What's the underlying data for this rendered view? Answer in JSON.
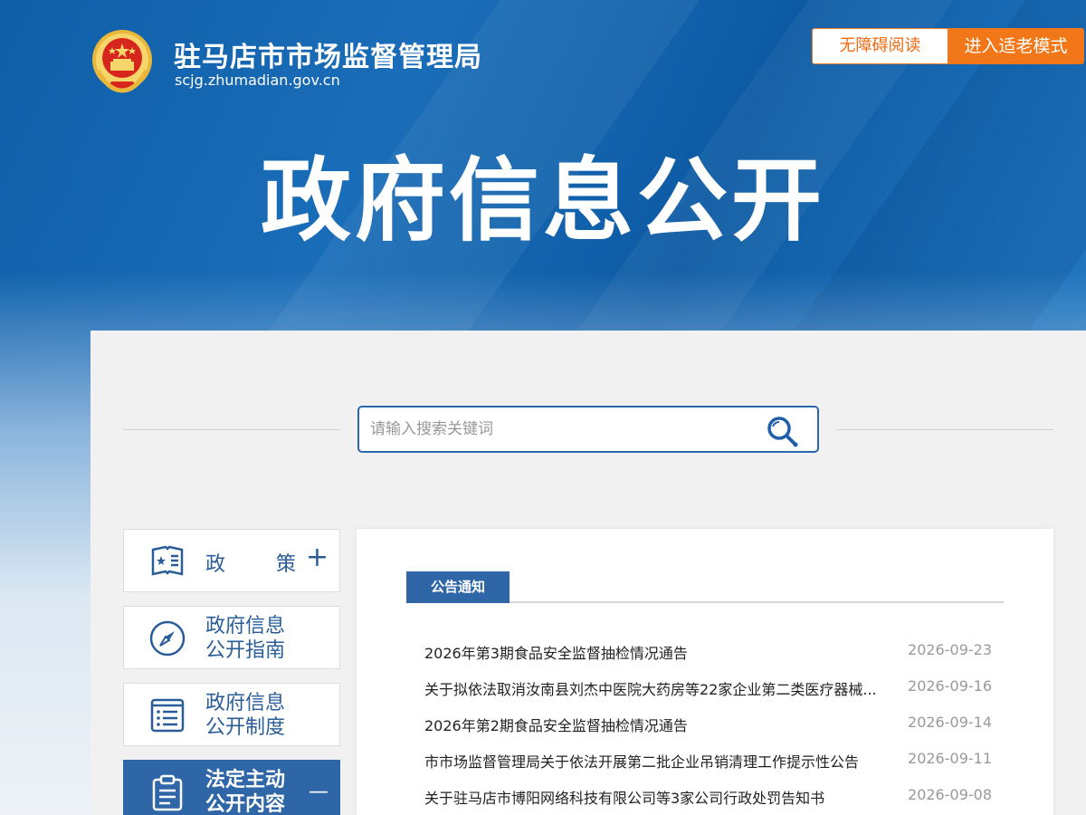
{
  "header": {
    "site_title": "驻马店市市场监督管理局",
    "site_url": "scjg.zhumadian.gov.cn",
    "accessibility_label": "无障碍阅读",
    "elder_mode_label": "进入适老模式"
  },
  "hero": {
    "title": "政府信息公开"
  },
  "search": {
    "placeholder": "请输入搜索关键词"
  },
  "sidebar": {
    "items": [
      {
        "label": "政策",
        "label_chars": [
          "政",
          "策"
        ],
        "toggle": "+",
        "icon": "policy-book-icon"
      },
      {
        "label_line1": "政府信息",
        "label_line2": "公开指南",
        "icon": "compass-icon"
      },
      {
        "label_line1": "政府信息",
        "label_line2": "公开制度",
        "icon": "list-document-icon"
      },
      {
        "label_line1": "法定主动",
        "label_line2": "公开内容",
        "toggle": "—",
        "icon": "clipboard-icon",
        "active": true
      }
    ]
  },
  "content": {
    "tab_label": "公告通知",
    "news": [
      {
        "title": "2026年第3期食品安全监督抽检情况通告",
        "date": "2026-09-23"
      },
      {
        "title": "关于拟依法取消汝南县刘杰中医院大药房等22家企业第二类医疗器械...",
        "date": "2026-09-16"
      },
      {
        "title": "2026年第2期食品安全监督抽检情况通告",
        "date": "2026-09-14"
      },
      {
        "title": "市市场监督管理局关于依法开展第二批企业吊销清理工作提示性公告",
        "date": "2026-09-11"
      },
      {
        "title": "关于驻马店市博阳网络科技有限公司等3家公司行政处罚告知书",
        "date": "2026-09-08"
      }
    ]
  },
  "colors": {
    "banner_blue": "#0f5ea8",
    "accent_blue": "#2f66a8",
    "orange": "#f27718",
    "emblem_red": "#d7261e",
    "emblem_gold": "#f3c64a"
  }
}
